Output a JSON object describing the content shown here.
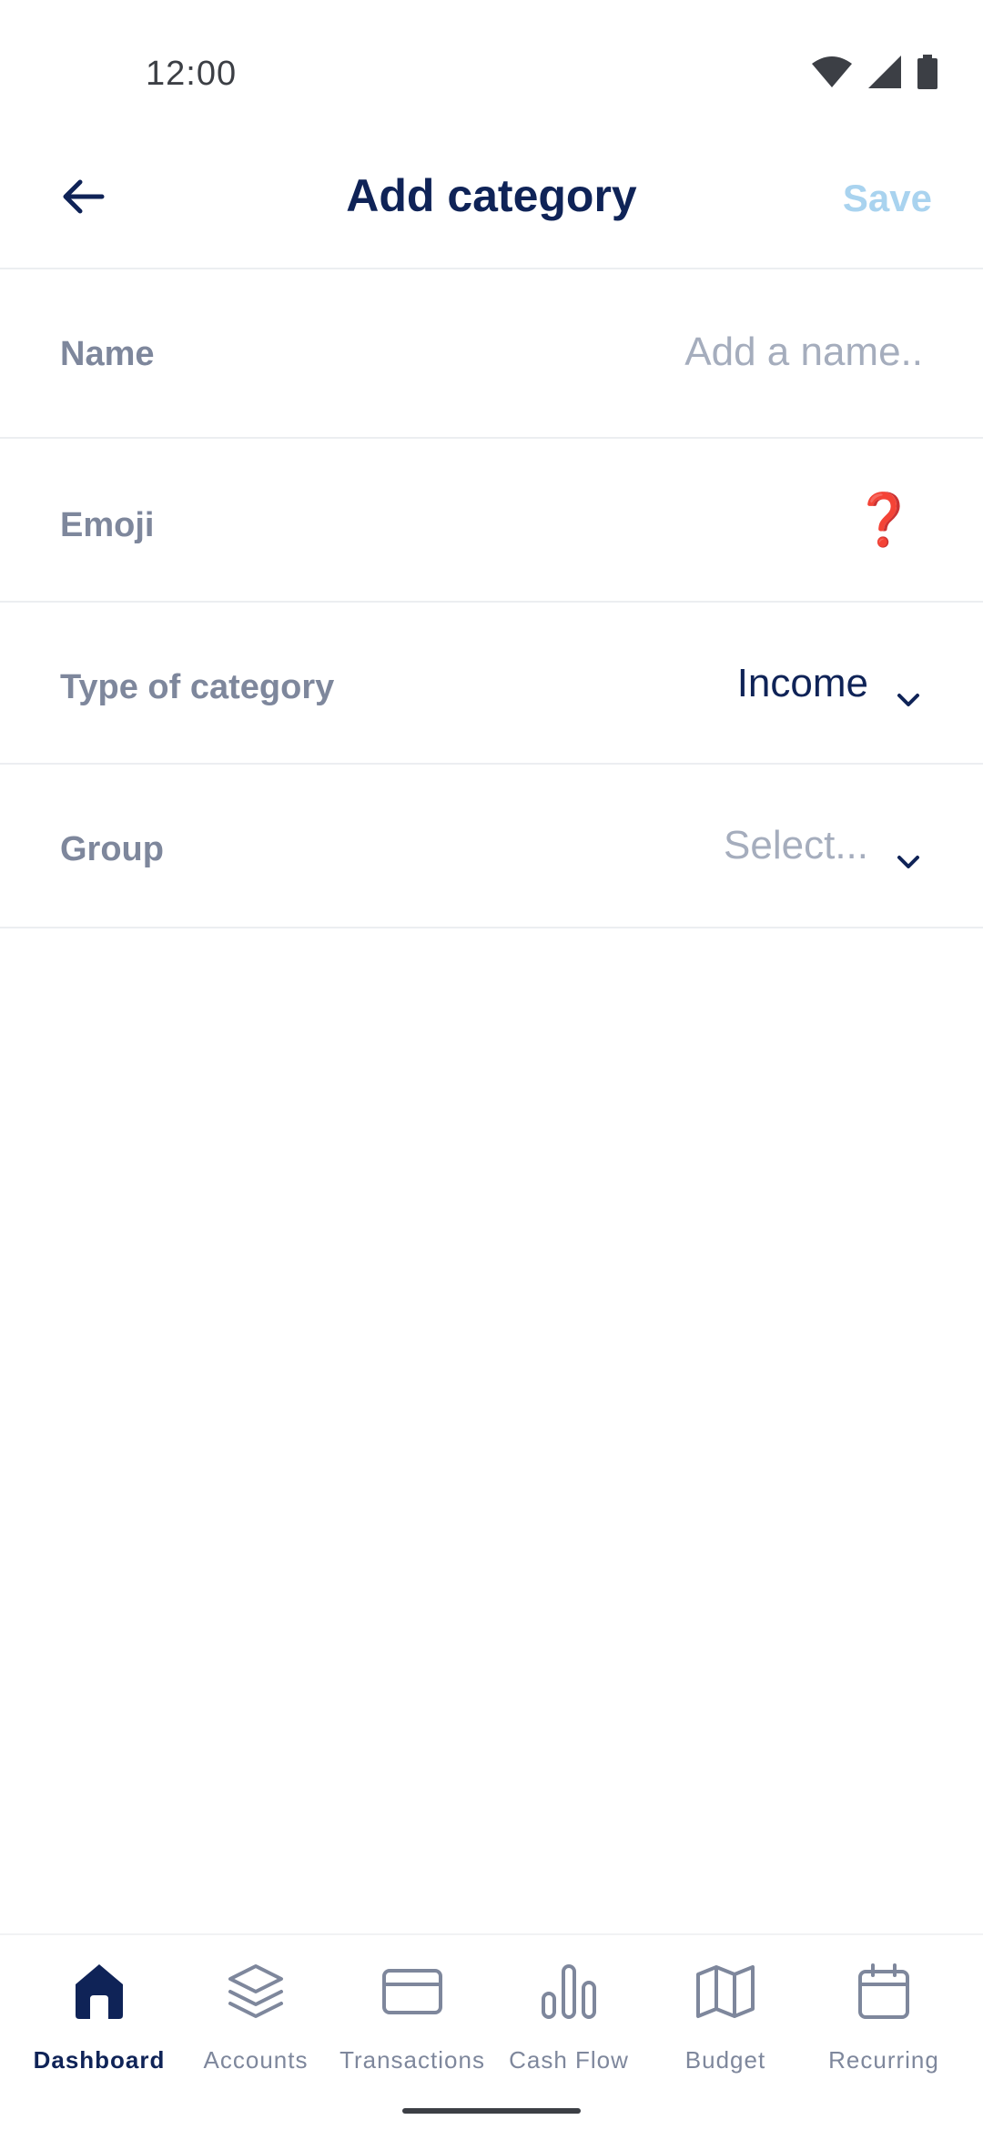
{
  "status_bar": {
    "time": "12:00",
    "icons": [
      "wifi-icon",
      "signal-icon",
      "battery-icon"
    ]
  },
  "header": {
    "title": "Add category",
    "save_label": "Save",
    "back_icon": "arrow-left-icon"
  },
  "form": {
    "name": {
      "label": "Name",
      "placeholder": "Add a name.."
    },
    "emoji": {
      "label": "Emoji",
      "value": "❓"
    },
    "type": {
      "label": "Type of category",
      "value": "Income"
    },
    "group": {
      "label": "Group",
      "placeholder": "Select..."
    }
  },
  "bottom_nav": {
    "items": [
      {
        "label": "Dashboard",
        "icon": "home-icon",
        "active": true
      },
      {
        "label": "Accounts",
        "icon": "layers-icon",
        "active": false
      },
      {
        "label": "Transactions",
        "icon": "credit-card-icon",
        "active": false
      },
      {
        "label": "Cash Flow",
        "icon": "bar-chart-icon",
        "active": false
      },
      {
        "label": "Budget",
        "icon": "map-icon",
        "active": false
      },
      {
        "label": "Recurring",
        "icon": "calendar-icon",
        "active": false
      }
    ]
  },
  "colors": {
    "primary": "#0f2357",
    "muted_label": "#7e879c",
    "placeholder": "#a5adbd",
    "save_disabled": "#a9d3ef",
    "emoji_red": "#d23c2f",
    "divider": "#eceef1"
  }
}
